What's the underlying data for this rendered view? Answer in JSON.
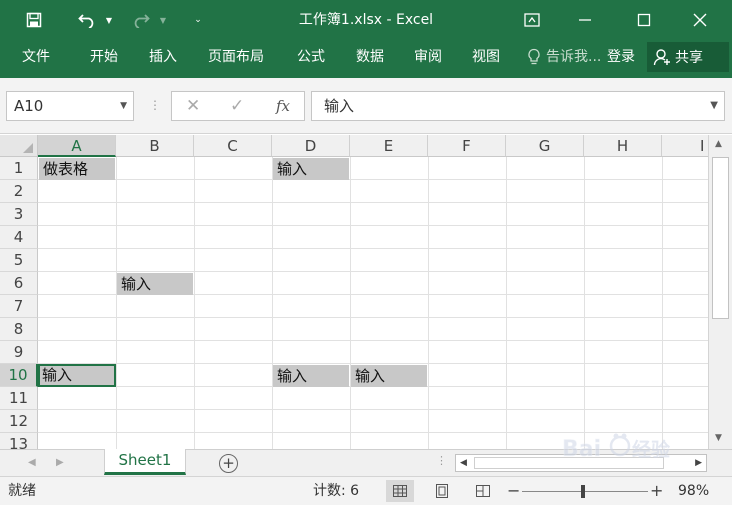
{
  "window": {
    "title": "工作簿1.xlsx - Excel"
  },
  "ribbon": {
    "tabs": [
      "文件",
      "开始",
      "插入",
      "页面布局",
      "公式",
      "数据",
      "审阅",
      "视图"
    ],
    "tell_me": "告诉我...",
    "login": "登录",
    "share": "共享"
  },
  "formula_bar": {
    "name_box": "A10",
    "fx_label": "fx",
    "value": "输入"
  },
  "grid": {
    "columns": [
      "A",
      "B",
      "C",
      "D",
      "E",
      "F",
      "G",
      "H",
      "I"
    ],
    "selected_column": "A",
    "rows": [
      "1",
      "2",
      "3",
      "4",
      "5",
      "6",
      "7",
      "8",
      "9",
      "10",
      "11",
      "12",
      "13"
    ],
    "selected_row": "10",
    "active_cell": "A10",
    "cells": [
      {
        "ref": "A1",
        "value": "做表格"
      },
      {
        "ref": "D1",
        "value": "输入"
      },
      {
        "ref": "B6",
        "value": "输入"
      },
      {
        "ref": "A10",
        "value": "输入"
      },
      {
        "ref": "D10",
        "value": "输入"
      },
      {
        "ref": "E10",
        "value": "输入"
      }
    ],
    "cell_fill": "#c8c8c8"
  },
  "sheets": {
    "tabs": [
      "Sheet1"
    ],
    "active": "Sheet1"
  },
  "status": {
    "ready": "就绪",
    "count": "计数: 6",
    "zoom": "98%",
    "zoom_value": 98
  },
  "colors": {
    "accent": "#217346",
    "accent_dark": "#185c37"
  },
  "watermark": "Baidu 经验"
}
